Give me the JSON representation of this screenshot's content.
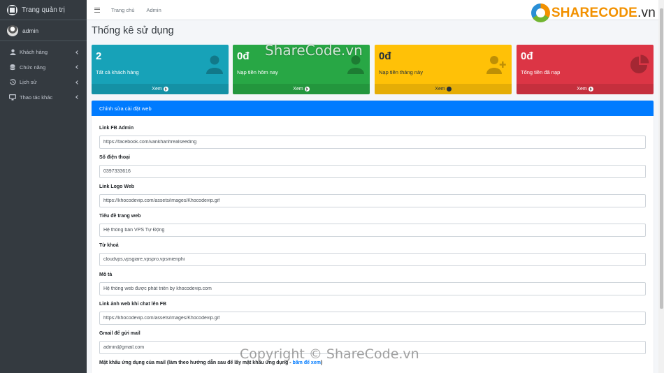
{
  "sidebar": {
    "brand": "Trang quản trị",
    "user": "admin",
    "items": [
      {
        "label": "Khách hàng",
        "icon": "user-icon"
      },
      {
        "label": "Chức năng",
        "icon": "database-icon"
      },
      {
        "label": "Lịch sử",
        "icon": "history-icon"
      },
      {
        "label": "Thao tác khác",
        "icon": "desktop-icon"
      }
    ]
  },
  "topbar": {
    "links": [
      "Trang chủ",
      "Admin"
    ],
    "logo": {
      "share": "SHARECODE",
      "vn": ".vn"
    }
  },
  "page": {
    "title": "Thống kê sử dụng"
  },
  "stats": [
    {
      "value": "2",
      "label": "Tất cả khách hàng",
      "footer": "Xem",
      "color": "#17a2b8",
      "icon": "user-icon"
    },
    {
      "value": "0đ",
      "label": "Nạp tiền hôm nay",
      "footer": "Xem",
      "color": "#28a745",
      "icon": "user-icon"
    },
    {
      "value": "0đ",
      "label": "Nạp tiền tháng này",
      "footer": "Xem",
      "color": "#ffc107",
      "icon": "user-plus-icon"
    },
    {
      "value": "0đ",
      "label": "Tổng tiền đã nạp",
      "footer": "Xem",
      "color": "#dc3545",
      "icon": "pie-chart-icon"
    }
  ],
  "settings": {
    "title": "Chỉnh sửa cài đặt web",
    "fields": [
      {
        "label": "Link FB Admin",
        "value": "https://facebook.com/vankhanhrealseeding"
      },
      {
        "label": "Số điện thoại",
        "value": "0397333616"
      },
      {
        "label": "Link Logo Web",
        "value": "https://khocodevip.com/assets/images/Khocodevip.gif"
      },
      {
        "label": "Tiêu đề trang web",
        "value": "Hệ thống bán VPS Tự Động"
      },
      {
        "label": "Từ khoá",
        "value": "cloudvps,vpsgiare,vpspro,vpsmienphi"
      },
      {
        "label": "Mô tả",
        "value": "Hệ thống web được phát triển by khocodevip.com"
      },
      {
        "label": "Link ảnh web khi chat lên FB",
        "value": "https://khocodevip.com/assets/images/Khocodevip.gif"
      },
      {
        "label": "Gmail để gửi mail",
        "value": "admin@gmail.com"
      }
    ],
    "last_label": "Mật khẩu ứng dụng của mail (làm theo hướng dẫn sau để lấy mật khẩu ứng dụng - ",
    "last_link": "bấm để xem",
    "last_close": ")"
  },
  "watermarks": {
    "top": "ShareCode.vn",
    "bottom": "Copyright © ShareCode.vn"
  }
}
